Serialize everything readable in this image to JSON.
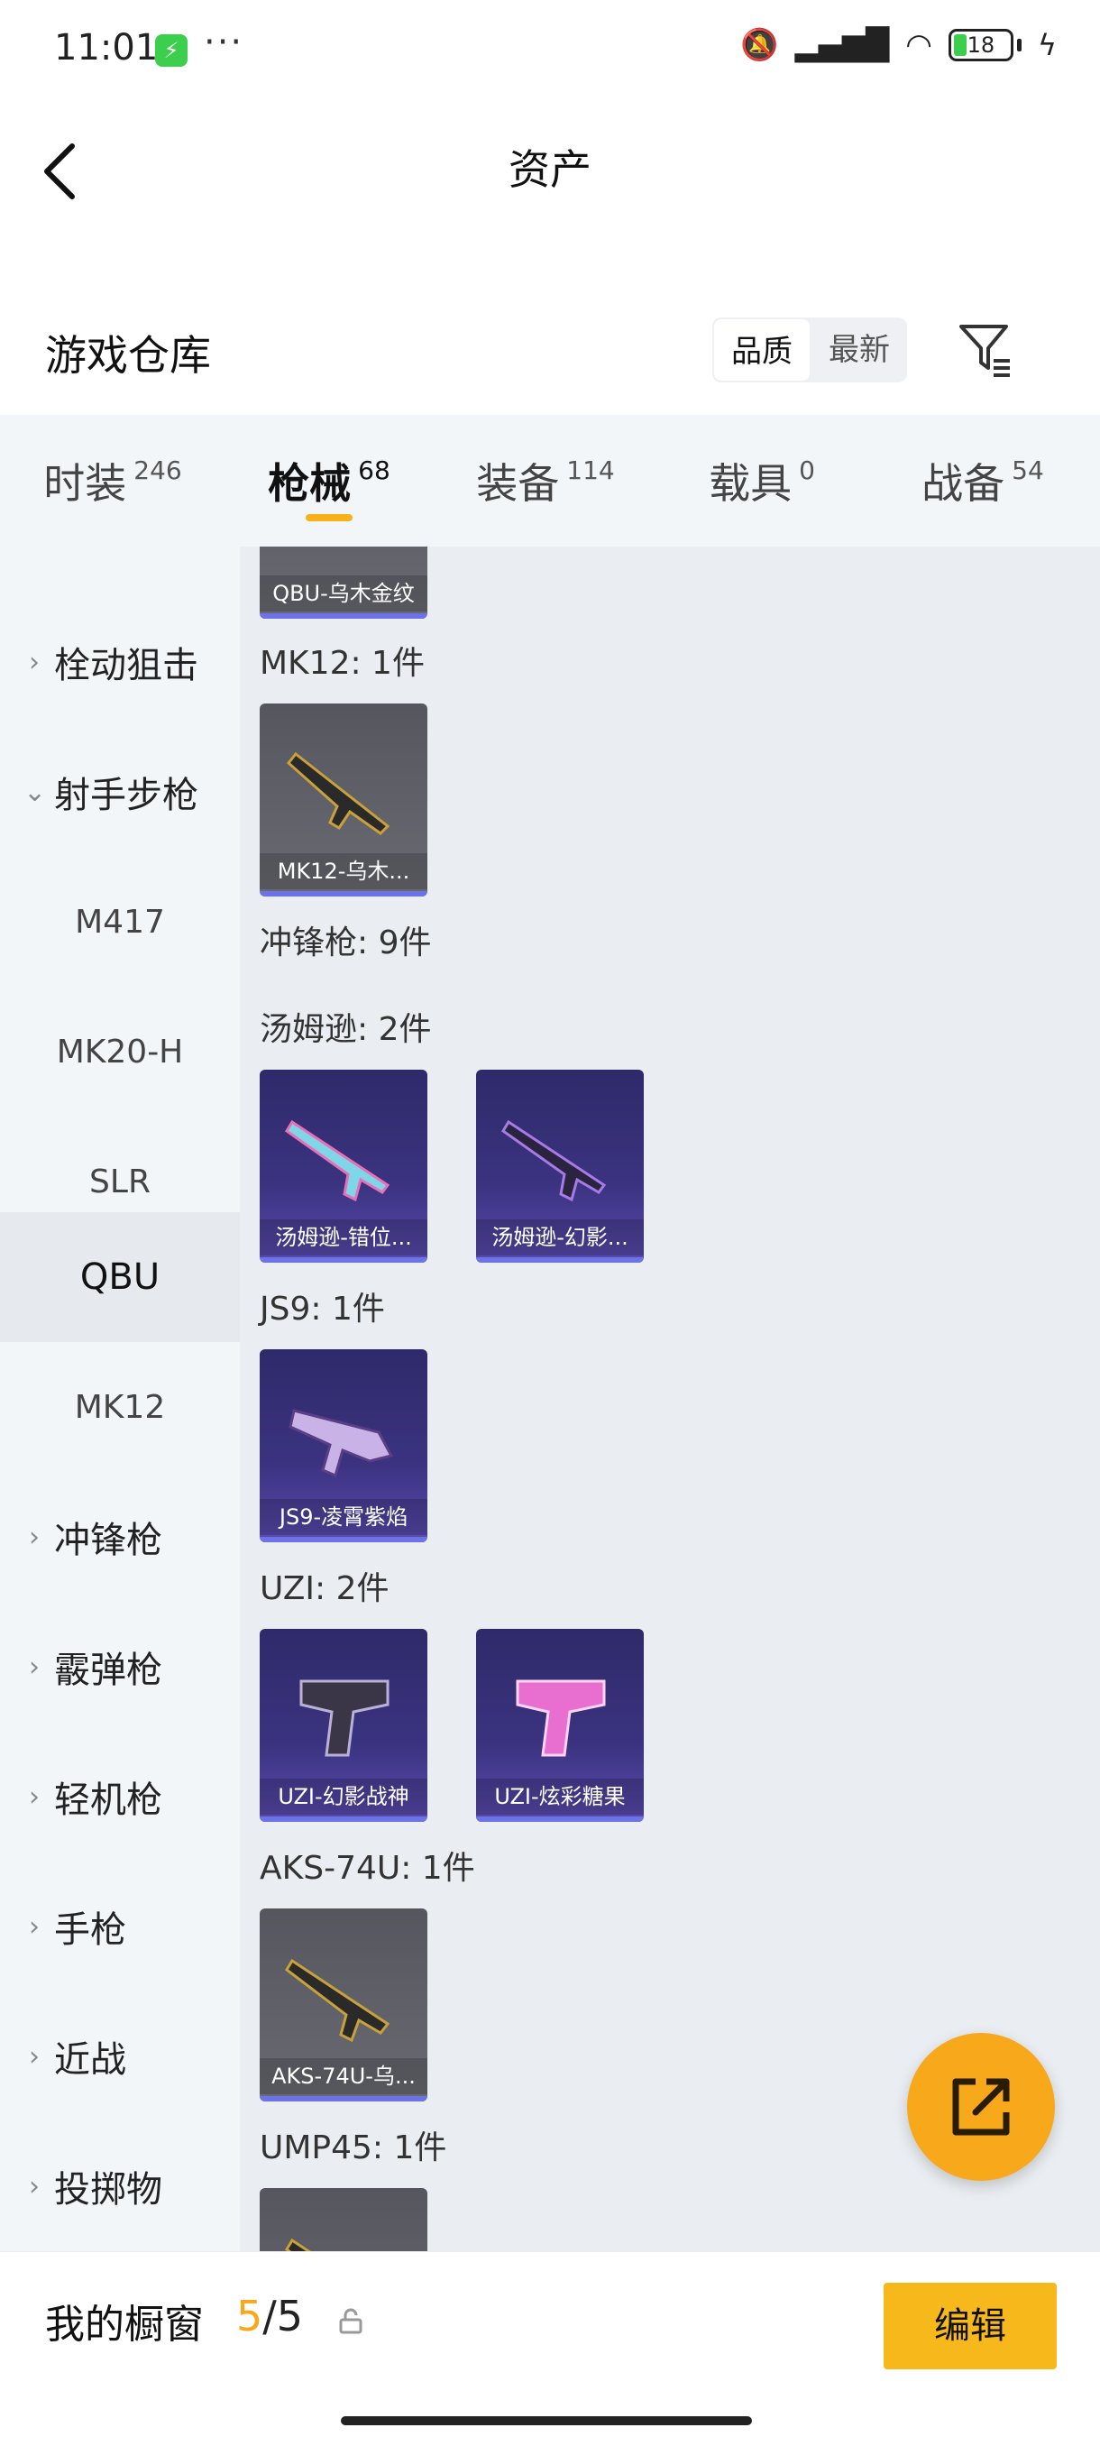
{
  "status_bar": {
    "time": "11:01",
    "battery_level": "18",
    "icons": [
      "app-notification-icon",
      "more-dots-icon",
      "mute-icon",
      "hd-signal-icon",
      "wifi-icon",
      "battery-icon",
      "charging-icon"
    ]
  },
  "nav": {
    "title": "资产",
    "back_icon": "back-arrow-icon"
  },
  "warehouse": {
    "title": "游戏仓库",
    "sort_options": [
      "品质",
      "最新"
    ],
    "active_sort": "品质",
    "filter_icon": "filter-icon"
  },
  "tabs": [
    {
      "label": "时装",
      "count": "246"
    },
    {
      "label": "枪械",
      "count": "68",
      "active": true
    },
    {
      "label": "装备",
      "count": "114"
    },
    {
      "label": "载具",
      "count": "0"
    },
    {
      "label": "战备",
      "count": "54"
    }
  ],
  "sidebar": {
    "items": [
      {
        "label": "栓动狙击",
        "type": "category",
        "expanded": false
      },
      {
        "label": "射手步枪",
        "type": "category",
        "expanded": true
      },
      {
        "label": "M417",
        "type": "sub"
      },
      {
        "label": "MK20-H",
        "type": "sub"
      },
      {
        "label": "SLR",
        "type": "sub"
      },
      {
        "label": "QBU",
        "type": "sub",
        "active": true
      },
      {
        "label": "MK12",
        "type": "sub"
      },
      {
        "label": "冲锋枪",
        "type": "category",
        "expanded": false
      },
      {
        "label": "霰弹枪",
        "type": "category",
        "expanded": false
      },
      {
        "label": "轻机枪",
        "type": "category",
        "expanded": false
      },
      {
        "label": "手枪",
        "type": "category",
        "expanded": false
      },
      {
        "label": "近战",
        "type": "category",
        "expanded": false
      },
      {
        "label": "投掷物",
        "type": "category",
        "expanded": false
      }
    ]
  },
  "content": {
    "partial_top_card": {
      "name": "QBU-乌木金纹",
      "style": "gray"
    },
    "sections": [
      {
        "title": "MK12: 1件",
        "items": [
          {
            "name": "MK12-乌木...",
            "style": "gray"
          }
        ]
      },
      {
        "title": "冲锋枪: 9件",
        "items": []
      },
      {
        "title": "汤姆逊: 2件",
        "items": [
          {
            "name": "汤姆逊-错位...",
            "style": "purple"
          },
          {
            "name": "汤姆逊-幻影...",
            "style": "purple"
          }
        ]
      },
      {
        "title": "JS9: 1件",
        "items": [
          {
            "name": "JS9-凌霄紫焰",
            "style": "purple"
          }
        ]
      },
      {
        "title": "UZI: 2件",
        "items": [
          {
            "name": "UZI-幻影战神",
            "style": "purple"
          },
          {
            "name": "UZI-炫彩糖果",
            "style": "purple"
          }
        ]
      },
      {
        "title": "AKS-74U: 1件",
        "items": [
          {
            "name": "AKS-74U-乌...",
            "style": "gray"
          }
        ]
      },
      {
        "title": "UMP45: 1件",
        "items": [
          {
            "name": "",
            "style": "gray"
          }
        ]
      }
    ]
  },
  "fab": {
    "icon": "share-external-icon"
  },
  "bottom_bar": {
    "label": "我的橱窗",
    "current": "5",
    "separator": "/",
    "total": "5",
    "lock_icon": "unlock-icon",
    "edit_label": "编辑"
  },
  "colors": {
    "accent": "#f7b21b",
    "card_gray": "#5e5e67",
    "card_purple": "#3b3380",
    "card_bar": "#6b73e6"
  }
}
